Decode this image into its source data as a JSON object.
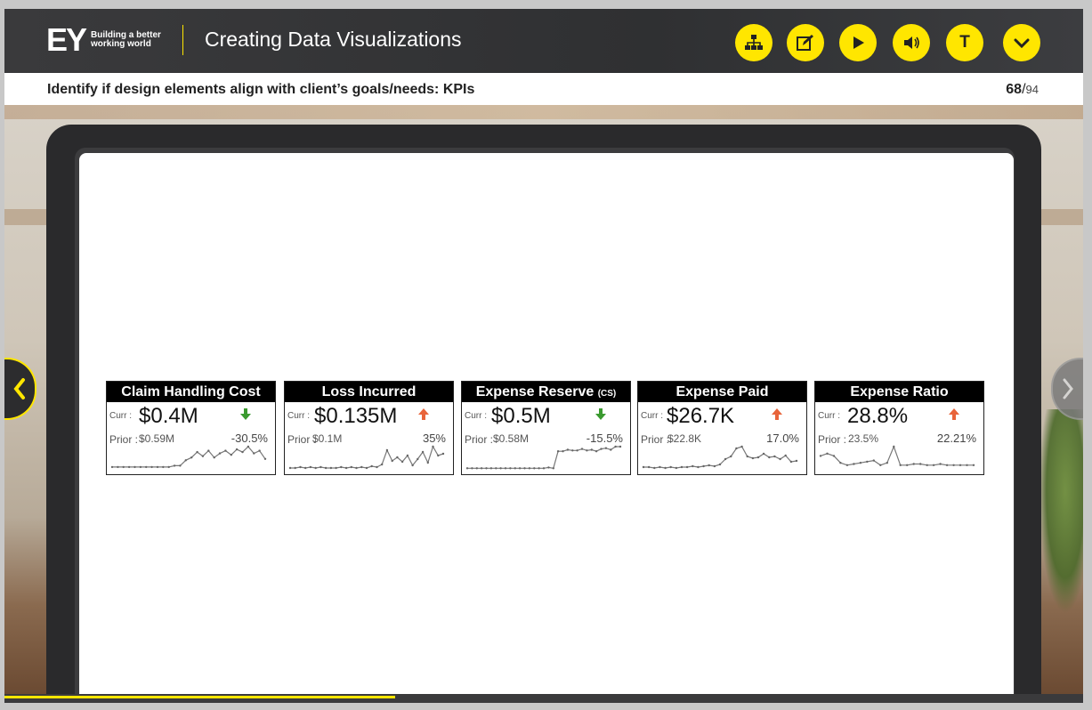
{
  "header": {
    "brand": "EY",
    "tagline_line1": "Building a better",
    "tagline_line2": "working world",
    "course_title": "Creating Data Visualizations",
    "buttons": [
      {
        "name": "sitemap-button",
        "icon": "sitemap-icon"
      },
      {
        "name": "notes-button",
        "icon": "edit-icon"
      },
      {
        "name": "play-button",
        "icon": "play-icon"
      },
      {
        "name": "volume-button",
        "icon": "speaker-icon"
      },
      {
        "name": "transcript-button",
        "label": "T",
        "icon": "text-icon"
      },
      {
        "name": "menu-button",
        "icon": "chevron-down-icon"
      }
    ]
  },
  "subheader": {
    "title": "Identify if design elements align with client’s goals/needs: KPIs",
    "page_current": "68",
    "page_sep": "/",
    "page_total": "94"
  },
  "progress": 0.362,
  "colors": {
    "accent": "#ffe600",
    "down": "#3a9a2f",
    "up": "#e8643a"
  },
  "kpis": [
    {
      "title": "Claim Handling Cost",
      "title_suffix": "",
      "curr_label": "Curr :",
      "curr": "$0.4M",
      "prior_label": "Prior :",
      "prior": "$0.59M",
      "change": "-30.5%",
      "direction": "down",
      "trend": [
        2,
        2,
        2,
        2,
        2,
        2,
        2,
        2,
        2,
        2,
        2,
        3,
        3,
        7,
        9,
        13,
        10,
        14,
        9,
        12,
        14,
        11,
        15,
        13,
        17,
        12,
        14,
        8
      ]
    },
    {
      "title": "Loss Incurred",
      "title_suffix": "",
      "curr_label": "Curr :",
      "curr": "$0.135M",
      "prior_label": "Prior :",
      "prior": "$0.1M",
      "change": "35%",
      "direction": "up",
      "trend": [
        2,
        2,
        3,
        2,
        3,
        2,
        3,
        2,
        2,
        2,
        3,
        2,
        3,
        2,
        3,
        2,
        4,
        3,
        6,
        22,
        10,
        14,
        9,
        16,
        5,
        12,
        20,
        8,
        26,
        16,
        18
      ]
    },
    {
      "title": "Expense Reserve",
      "title_suffix": "(CS)",
      "curr_label": "Curr :",
      "curr": "$0.5M",
      "prior_label": "Prior :",
      "prior": "$0.58M",
      "change": "-15.5%",
      "direction": "down",
      "trend": [
        2,
        2,
        2,
        2,
        2,
        2,
        2,
        2,
        2,
        2,
        2,
        2,
        2,
        2,
        2,
        2,
        2,
        3,
        2,
        24,
        24,
        26,
        25,
        25,
        27,
        25,
        26,
        24,
        27,
        28,
        26,
        30,
        30
      ]
    },
    {
      "title": "Expense Paid",
      "title_suffix": "",
      "curr_label": "Curr :",
      "curr": "$26.7K",
      "prior_label": "Prior :",
      "prior": "$22.8K",
      "change": "17.0%",
      "direction": "up",
      "trend": [
        3,
        3,
        2,
        3,
        2,
        3,
        2,
        3,
        3,
        4,
        3,
        4,
        5,
        4,
        6,
        12,
        15,
        24,
        26,
        15,
        13,
        14,
        18,
        14,
        15,
        12,
        16,
        9,
        10
      ]
    },
    {
      "title": "Expense Ratio",
      "title_suffix": "",
      "curr_label": "Curr :",
      "curr": "28.8%",
      "prior_label": "Prior :",
      "prior": "23.5%",
      "change": "22.21%",
      "direction": "up",
      "trend": [
        12,
        14,
        12,
        6,
        4,
        5,
        6,
        7,
        8,
        4,
        6,
        20,
        4,
        4,
        5,
        5,
        4,
        4,
        5,
        4,
        4,
        4,
        4,
        4
      ]
    }
  ]
}
